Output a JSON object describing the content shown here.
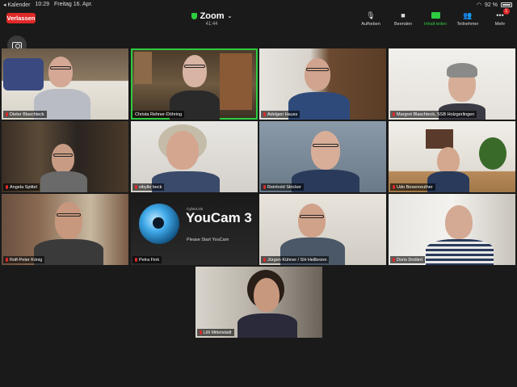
{
  "statusbar": {
    "back_app": "◂ Kalender",
    "time": "10:29",
    "date": "Freitag 16. Apr.",
    "battery": "92 %"
  },
  "header": {
    "leave_label": "Verlassen",
    "title": "Zoom",
    "timer": "41:44"
  },
  "toolbar": [
    {
      "name": "aufheben",
      "label": "Aufheben",
      "icon": "mic-icon"
    },
    {
      "name": "beenden",
      "label": "Beenden",
      "icon": "video-icon"
    },
    {
      "name": "inhalt-teilen",
      "label": "Inhalt teilen",
      "icon": "share-icon"
    },
    {
      "name": "teilnehmer",
      "label": "Teilnehmer",
      "icon": "participants-icon"
    },
    {
      "name": "mehr",
      "label": "Mehr",
      "icon": "more-icon",
      "badge": "1"
    }
  ],
  "participants": [
    {
      "name": "Dieter Blaschteck"
    },
    {
      "name": "Christa Rehner-Döhring"
    },
    {
      "name": "Adelgen Hauss"
    },
    {
      "name": "Margret Blaschteck, SSB Holzgerlingen"
    },
    {
      "name": "Angela Spittel"
    },
    {
      "name": "sibylle beck"
    },
    {
      "name": "Reinhold Stricker"
    },
    {
      "name": "Udo Besenreuther"
    },
    {
      "name": "Rolf-Peter König"
    },
    {
      "name": "Petra Fink"
    },
    {
      "name": "Jürgen Kühner / SH Heilbronn"
    },
    {
      "name": "Doris Drollert"
    },
    {
      "name": "Lilli Mittelstädt"
    }
  ],
  "youcam": {
    "brand": "CyberLink",
    "title": "YouCam 3",
    "subtitle": "Please Start YouCam"
  },
  "colors": {
    "leave_button": "#e02828",
    "active_speaker": "#2ecc40",
    "share_green": "#2ecc40"
  }
}
